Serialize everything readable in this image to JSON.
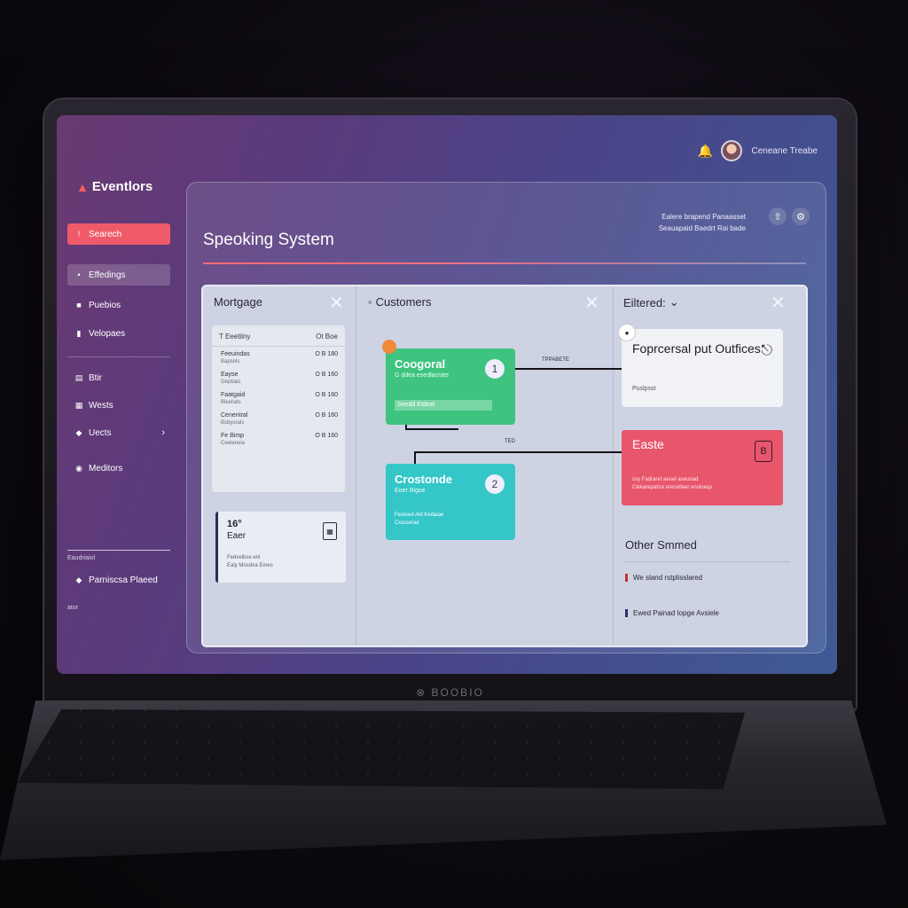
{
  "device": {
    "brand": "⊗ BOOBIO"
  },
  "topbar": {
    "notification_icon": "bell-icon",
    "user_name": "Ceneane Treabe"
  },
  "sidebar": {
    "logo": "Eventlors",
    "items": [
      {
        "label": "Searech",
        "icon": "search-icon",
        "state": "active"
      },
      {
        "label": "Effedings",
        "icon": "tag-icon",
        "state": "selected"
      },
      {
        "label": "Puebios",
        "icon": "doc-icon",
        "state": "normal"
      },
      {
        "label": "Velopaes",
        "icon": "chart-icon",
        "state": "normal"
      },
      {
        "label": "Btir",
        "icon": "list-icon",
        "state": "normal"
      },
      {
        "label": "Wests",
        "icon": "grid-icon",
        "state": "normal"
      },
      {
        "label": "Uects",
        "icon": "shield-icon",
        "state": "normal"
      },
      {
        "label": "Meditors",
        "icon": "tool-icon",
        "state": "normal"
      }
    ],
    "footer_label": "Eaudriaiol",
    "footer_item": "Parniscsa Plaeed",
    "footer_small": "ator"
  },
  "header": {
    "title": "Speoking System",
    "info_line1": "Ealere brapend Panaasset",
    "info_line2": "Seauapaid Baedrt Rai bade"
  },
  "columns": {
    "message": {
      "title": "Mortgage",
      "table_head": [
        "T Eeetilny",
        "Ot Boe"
      ],
      "rows": [
        {
          "name": "Feeuindas",
          "sub": "Bapsels",
          "value": "O B 180"
        },
        {
          "name": "Eayse",
          "sub": "Gepbais",
          "value": "O B 160"
        },
        {
          "name": "Faatgaid",
          "sub": "Bleeliats",
          "value": "O B 160"
        },
        {
          "name": "Cenentral",
          "sub": "Bsbyorals",
          "value": "O B 160"
        },
        {
          "name": "Fe Bimp",
          "sub": "Ceelaneia",
          "value": "O B 160"
        }
      ],
      "note": {
        "number": "16°",
        "label": "Eaer",
        "small1": "Fedvelbse enl",
        "small2": "Ealy Mosdoa Emes"
      }
    },
    "customers": {
      "title": "Customers",
      "card1": {
        "title": "Coogoral",
        "subtitle": "G ddea esedlacrate",
        "badge": "1",
        "progress_label": "Seedd Etdeal"
      },
      "card2": {
        "title": "Crostonde",
        "subtitle": "Eoer Bigoe",
        "badge": "2",
        "line1": "Festeed Ald Kedaiae",
        "line2": "Crosserae"
      },
      "connector_label1": "TPPABETE",
      "connector_label2": "TED"
    },
    "filtered": {
      "title": "Eiltered:",
      "card_prop": {
        "title": "Foprcersal put Outfices",
        "sub": "Puslpsst"
      },
      "card_alert": {
        "title": "Easte",
        "line1": "ssy Fadraret aeuel aseunad",
        "line2": "Clekarepahra erecetleer enoloeqs"
      },
      "other_title": "Other Smmed",
      "other_items": [
        "We sland rstplisslared",
        "Ewed Painad Iopge Avsiele"
      ]
    }
  },
  "colors": {
    "accent": "#ef5a6a",
    "green": "#3ec47f",
    "teal": "#35c6c8",
    "alert": "#e8566c"
  }
}
